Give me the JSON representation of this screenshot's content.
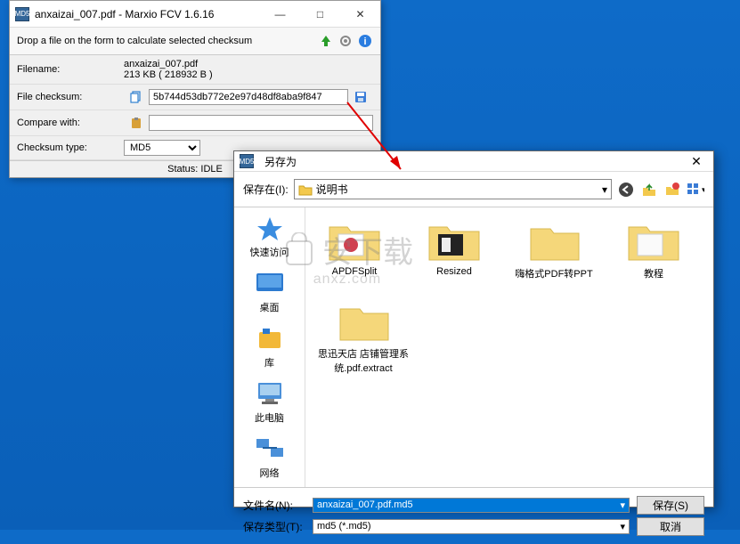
{
  "main": {
    "title": "anxaizai_007.pdf - Marxio FCV 1.6.16",
    "drop_hint": "Drop a file on the form to calculate selected checksum",
    "filename_label": "Filename:",
    "filename_value": "anxaizai_007.pdf",
    "filesize": "213 KB ( 218932 B )",
    "checksum_label": "File checksum:",
    "checksum_value": "5b744d53db772e2e97d48df8aba9f847",
    "compare_label": "Compare with:",
    "compare_value": "",
    "type_label": "Checksum type:",
    "type_value": "MD5",
    "status": "Status: IDLE"
  },
  "dialog": {
    "title": "另存为",
    "save_in_label": "保存在(I):",
    "save_in_value": "说明书",
    "sidebar": {
      "quick": "快速访问",
      "desktop": "桌面",
      "library": "库",
      "thispc": "此电脑",
      "network": "网络"
    },
    "files": {
      "f1": "APDFSplit",
      "f2": "Resized",
      "f3": "嗨格式PDF转PPT",
      "f4": "教程",
      "f5": "思迅天店 店铺管理系统.pdf.extract"
    },
    "filename_label": "文件名(N):",
    "filename_value": "anxaizai_007.pdf.md5",
    "filetype_label": "保存类型(T):",
    "filetype_value": "md5 (*.md5)",
    "save_btn": "保存(S)",
    "cancel_btn": "取消"
  },
  "watermark": {
    "main": "安下载",
    "sub": "anxz.com"
  }
}
